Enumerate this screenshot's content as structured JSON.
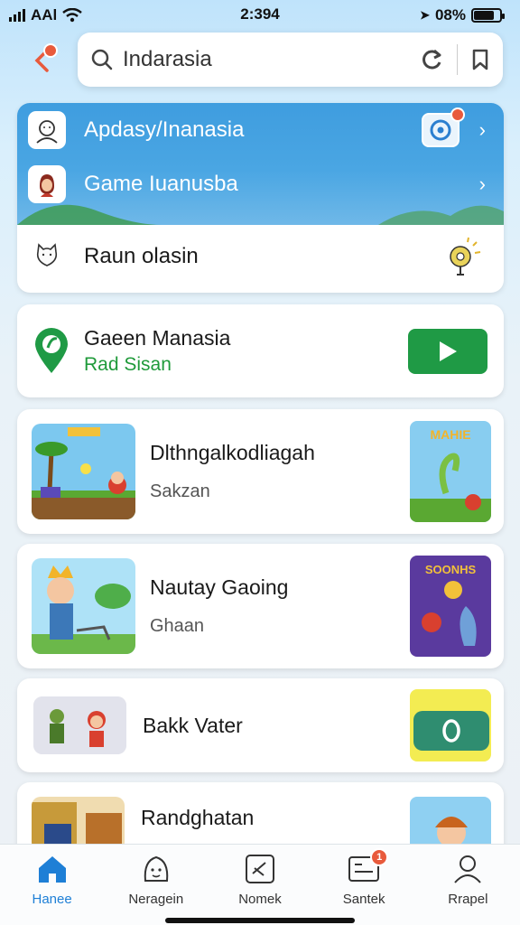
{
  "status": {
    "carrier": "AAl",
    "time": "2:394",
    "battery": "08%"
  },
  "header": {
    "back_badge": "",
    "search_placeholder": "Indarasia",
    "search_value": "Indarasia"
  },
  "menu": {
    "items": [
      {
        "label": "Apdasy/Inanasia",
        "badge": ""
      },
      {
        "label": "Game Iuanusba"
      },
      {
        "label": "Raun olasin"
      }
    ]
  },
  "featured": {
    "title": "Gaeen Manasia",
    "subtitle": "Rad Sisan"
  },
  "list": [
    {
      "title": "Dlthngalkodliagah",
      "subtitle": "Sakzan",
      "side_label": "MAHIE"
    },
    {
      "title": "Nautay Gaoing",
      "subtitle": "Ghaan",
      "side_label": "SOONHS"
    },
    {
      "title": "Bakk Vater",
      "subtitle": ""
    },
    {
      "title": "Randghatan",
      "subtitle": ""
    }
  ],
  "nav": [
    {
      "label": "Hanee",
      "icon": "home-icon",
      "active": true
    },
    {
      "label": "Neragein",
      "icon": "avatar-icon"
    },
    {
      "label": "Nomek",
      "icon": "edit-icon"
    },
    {
      "label": "Santek",
      "icon": "card-icon",
      "badge": "1"
    },
    {
      "label": "Rrapel",
      "icon": "profile-icon"
    }
  ],
  "colors": {
    "accent": "#1e7fd6",
    "play": "#1f9a45",
    "badge": "#e85a3c",
    "banner": "#4aa6e3"
  }
}
